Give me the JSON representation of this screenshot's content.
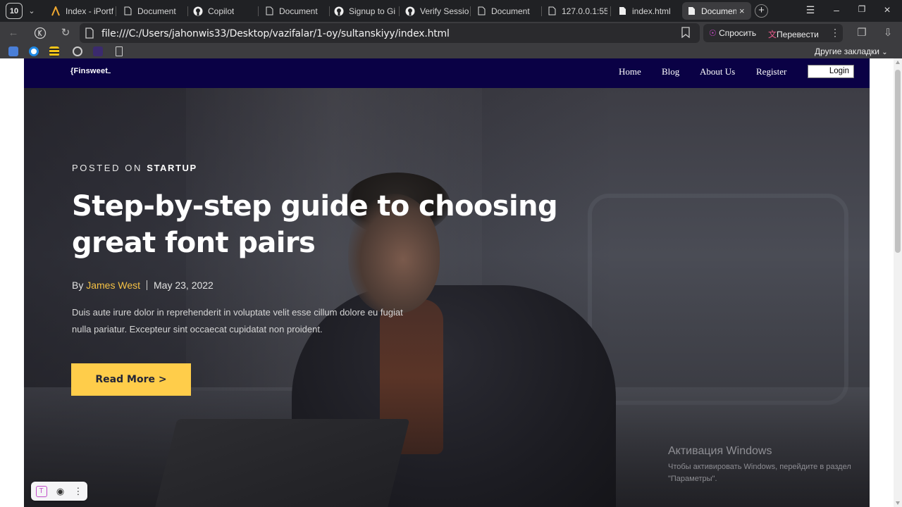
{
  "browser": {
    "tab_count": "10",
    "tabs": [
      {
        "title": "Index - iPortf",
        "icon": "a-icon"
      },
      {
        "title": "Document",
        "icon": "page-icon"
      },
      {
        "title": "Copilot",
        "icon": "github-icon"
      },
      {
        "title": "Document",
        "icon": "page-icon"
      },
      {
        "title": "Signup to Gi",
        "icon": "github-icon"
      },
      {
        "title": "Verify Sessio",
        "icon": "github-icon"
      },
      {
        "title": "Document",
        "icon": "page-icon"
      },
      {
        "title": "127.0.0.1:55(",
        "icon": "page-icon"
      },
      {
        "title": "index.html",
        "icon": "file-icon"
      },
      {
        "title": "Document",
        "icon": "file-icon",
        "active": true
      }
    ],
    "url": "file:///C:/Users/jahonwis33/Desktop/vazifalar/1-oy/sultanskiyy/index.html",
    "ask_label": "Спросить",
    "translate_label": "Перевести",
    "other_bookmarks": "Другие закладки"
  },
  "site": {
    "logo": "{Finsweet",
    "nav": {
      "home": "Home",
      "blog": "Blog",
      "about": "About Us",
      "register": "Register",
      "login": "Login"
    },
    "hero": {
      "eyebrow_prefix": "POSTED ON",
      "eyebrow_category": "STARTUP",
      "headline": "Step-by-step guide to choosing great font pairs",
      "by": "By",
      "author": "James West",
      "date": "May 23, 2022",
      "excerpt": "Duis aute irure dolor in reprehenderit in voluptate velit esse cillum dolore eu fugiat nulla pariatur. Excepteur sint occaecat cupidatat non proident.",
      "cta": "Read More >"
    }
  },
  "os": {
    "watermark_title": "Активация Windows",
    "watermark_text": "Чтобы активировать Windows, перейдите в раздел \"Параметры\"."
  },
  "colors": {
    "nav_bg": "#0a0145",
    "accent": "#ffcd4a",
    "author": "#f5c144"
  }
}
